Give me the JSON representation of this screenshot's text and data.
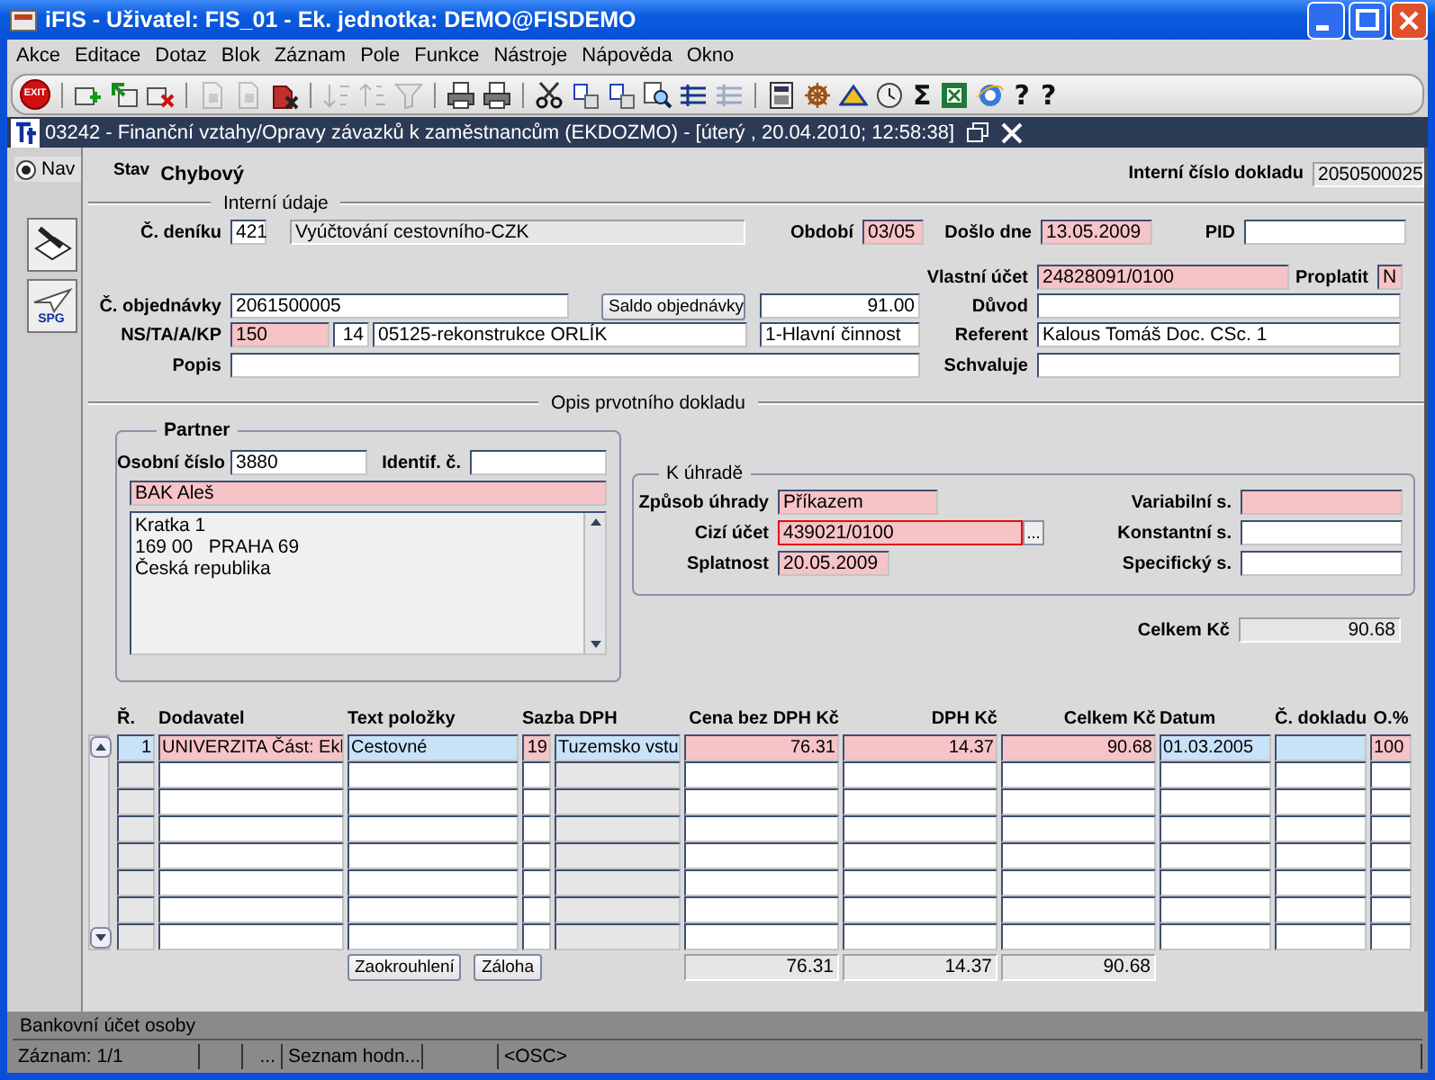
{
  "window": {
    "title": "iFIS - Uživatel: FIS_01 - Ek. jednotka: DEMO@FISDEMO"
  },
  "menu": [
    "Akce",
    "Editace",
    "Dotaz",
    "Blok",
    "Záznam",
    "Pole",
    "Funkce",
    "Nástroje",
    "Nápověda",
    "Okno"
  ],
  "toolbar": [
    {
      "kind": "exit",
      "label": "EXIT",
      "disabled": false
    },
    {
      "kind": "separator"
    },
    {
      "kind": "add",
      "disabled": false
    },
    {
      "kind": "insert",
      "disabled": false
    },
    {
      "kind": "remove",
      "disabled": false
    },
    {
      "kind": "separator"
    },
    {
      "kind": "copy",
      "disabled": true
    },
    {
      "kind": "paste",
      "disabled": true
    },
    {
      "kind": "drop",
      "disabled": false
    },
    {
      "kind": "separator"
    },
    {
      "kind": "sort_up",
      "disabled": true
    },
    {
      "kind": "sort_down",
      "disabled": true
    },
    {
      "kind": "filter",
      "disabled": true
    },
    {
      "kind": "separator"
    },
    {
      "kind": "print",
      "disabled": false
    },
    {
      "kind": "preview",
      "disabled": false
    },
    {
      "kind": "separator"
    },
    {
      "kind": "cut",
      "disabled": false
    },
    {
      "kind": "text1",
      "disabled": false
    },
    {
      "kind": "text2",
      "disabled": false
    },
    {
      "kind": "find",
      "disabled": false
    },
    {
      "kind": "list",
      "disabled": false
    },
    {
      "kind": "list",
      "disabled": true
    },
    {
      "kind": "separator"
    },
    {
      "kind": "calc",
      "disabled": false
    },
    {
      "kind": "wheel",
      "disabled": false
    },
    {
      "kind": "peak",
      "disabled": false
    },
    {
      "kind": "clock",
      "disabled": false
    },
    {
      "kind": "glyph",
      "glyph": "Σ",
      "disabled": false
    },
    {
      "kind": "excel",
      "disabled": false
    },
    {
      "kind": "web",
      "disabled": false
    },
    {
      "kind": "glyph",
      "glyph": "?",
      "disabled": false
    },
    {
      "kind": "glyph",
      "glyph": "?",
      "disabled": false
    }
  ],
  "form_window": {
    "title": "03242 - Finanční vztahy/Opravy závazků k zaměstnancům (EKDOZMO) - [úterý  , 20.04.2010; 12:58:38]"
  },
  "nav": {
    "label": "Nav",
    "selected": true
  },
  "side_buttons": [
    {
      "kind": "edit"
    },
    {
      "kind": "spg",
      "label": "SPG"
    }
  ],
  "header": {
    "status_label": "Stav",
    "status": "Chybový",
    "doc": {
      "label": "Interní číslo dokladu",
      "value": "2050500025",
      "kind": "readonly"
    }
  },
  "internal": {
    "title": "Interní údaje",
    "journal": {
      "label": "Č. deníku",
      "value": "421",
      "kind": "plain"
    },
    "journal_name": {
      "value": "Vyúčtování cestovního-CZK",
      "kind": "readonly"
    },
    "period": {
      "label": "Období",
      "value": "03/05",
      "kind": "required"
    },
    "received": {
      "label": "Došlo dne",
      "value": "13.05.2009",
      "kind": "required"
    },
    "pid": {
      "label": "PID",
      "kind": "plain"
    },
    "own_account": {
      "label": "Vlastní účet",
      "value": "24828091/0100",
      "kind": "required"
    },
    "pay": {
      "label": "Proplatit",
      "value": "N",
      "kind": "required"
    },
    "order": {
      "label": "Č. objednávky",
      "value": "2061500005",
      "kind": "plain"
    },
    "order_balance_button": "Saldo objednávky",
    "order_amount": {
      "value": "91.00",
      "kind": "plain"
    },
    "reason": {
      "label": "Důvod",
      "kind": "plain"
    },
    "cost_center": {
      "label": "NS/TA/A/KP",
      "value": "150",
      "kind": "required"
    },
    "task": {
      "value": "14",
      "kind": "plain"
    },
    "action": {
      "value": "05125-rekonstrukce ORLÍK",
      "kind": "plain"
    },
    "activity": {
      "value": "1-Hlavní činnost",
      "kind": "plain"
    },
    "referent": {
      "label": "Referent",
      "value": "Kalous Tomáš Doc. CSc. 1",
      "kind": "plain"
    },
    "description": {
      "label": "Popis",
      "kind": "plain"
    },
    "approver": {
      "label": "Schvaluje",
      "kind": "plain"
    }
  },
  "source_doc": {
    "title": "Opis prvotního dokladu"
  },
  "partner": {
    "title": "Partner",
    "personal_no": {
      "label": "Osobní číslo",
      "value": "3880",
      "kind": "plain"
    },
    "ident": {
      "label": "Identif. č.",
      "kind": "plain"
    },
    "name": {
      "value": "BAK Aleš",
      "kind": "required"
    },
    "address": [
      "Kratka 1",
      "169 00   PRAHA 69",
      "Česká republika"
    ]
  },
  "payment": {
    "title": "K úhradě",
    "method": {
      "label": "Způsob úhrady",
      "value": "Příkazem",
      "kind": "required"
    },
    "account": {
      "label": "Cizí účet",
      "value": "439021/0100",
      "kind": "required",
      "focused": true
    },
    "lov_button": "...",
    "due": {
      "label": "Splatnost",
      "value": "20.05.2009",
      "kind": "required"
    },
    "var_symbol": {
      "label": "Variabilní s.",
      "kind": "required"
    },
    "const_symbol": {
      "label": "Konstantní s.",
      "kind": "plain"
    },
    "spec_symbol": {
      "label": "Specifický s.",
      "kind": "plain"
    }
  },
  "total": {
    "label": "Celkem Kč",
    "value": "90.68",
    "kind": "readonly"
  },
  "table": {
    "columns": [
      {
        "label": "Ř.",
        "readonly": true
      },
      {
        "label": "Dodavatel",
        "readonly": false
      },
      {
        "label": "Text položky",
        "readonly": false
      },
      {
        "label": "Sazba DPH",
        "readonly": false
      },
      {
        "readonly": true
      },
      {
        "label": "Cena bez DPH Kč",
        "readonly": false
      },
      {
        "label": "DPH Kč",
        "readonly": false
      },
      {
        "label": "Celkem Kč",
        "readonly": false
      },
      {
        "label": "Datum",
        "readonly": false
      },
      {
        "label": "Č. dokladu",
        "readonly": false
      },
      {
        "label": "O.%",
        "readonly": false
      }
    ],
    "rows": [
      {
        "selected": true,
        "cells": [
          {
            "text": "1",
            "kind": "plain"
          },
          {
            "text": "UNIVERZITA Část: Ekl",
            "kind": "required"
          },
          {
            "text": "Cestovné",
            "kind": "plain"
          },
          {
            "text": "19",
            "kind": "required"
          },
          {
            "text": "Tuzemsko vstu",
            "kind": "plain"
          },
          {
            "text": "76.31",
            "kind": "required"
          },
          {
            "text": "14.37",
            "kind": "required"
          },
          {
            "text": "90.68",
            "kind": "required"
          },
          {
            "text": "01.03.2005",
            "kind": "plain"
          },
          {
            "kind": "plain"
          },
          {
            "text": "100",
            "kind": "required"
          }
        ]
      },
      {
        "selected": false
      },
      {
        "selected": false
      },
      {
        "selected": false
      },
      {
        "selected": false
      },
      {
        "selected": false
      },
      {
        "selected": false
      },
      {
        "selected": false
      }
    ],
    "buttons": [
      "Zaokrouhlení",
      "Záloha"
    ],
    "totals": [
      "76.31",
      "14.37",
      "90.68"
    ]
  },
  "status_bar": {
    "message": "Bankovní účet osoby",
    "record": "Záznam: 1/1",
    "field_3": "...",
    "list": "Seznam hodn...",
    "mode": "<OSC>"
  }
}
